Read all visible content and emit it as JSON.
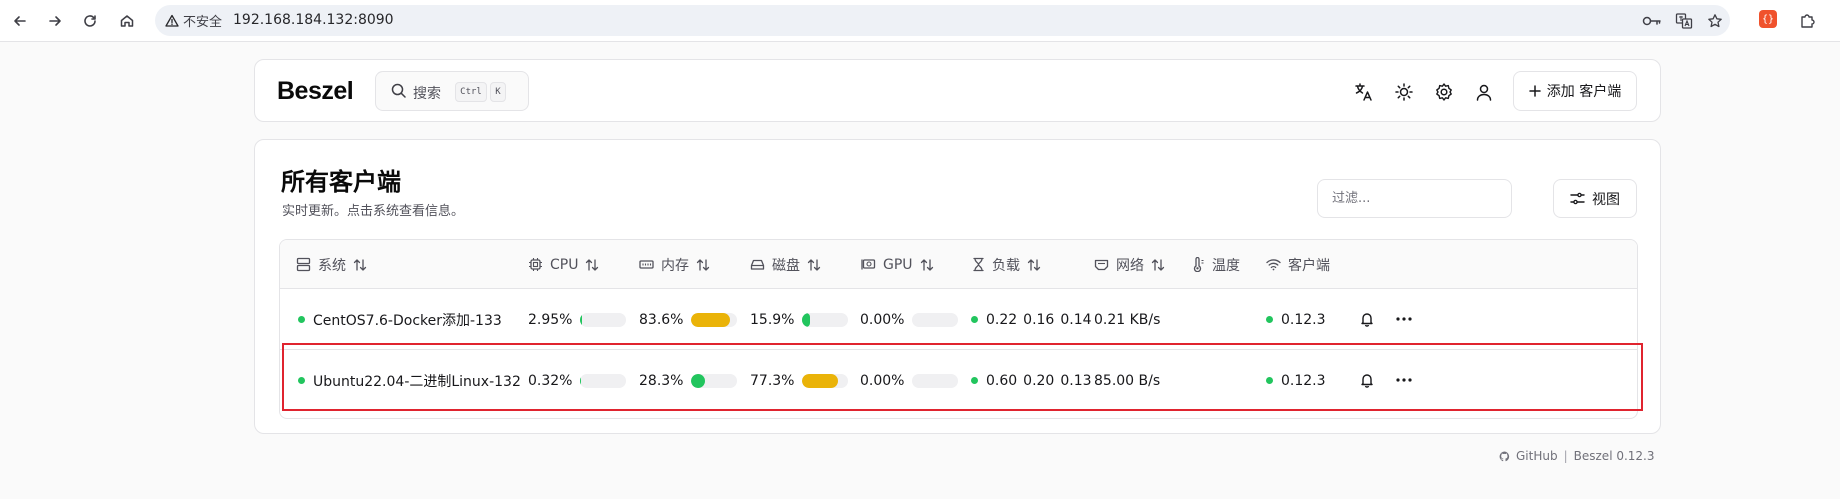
{
  "browser": {
    "security_label": "不安全",
    "url": "192.168.184.132:8090"
  },
  "header": {
    "logo": "Beszel",
    "search_label": "搜索",
    "kbd_ctrl": "Ctrl",
    "kbd_k": "K",
    "add_client_label": "添加 客户端"
  },
  "page": {
    "title": "所有客户端",
    "subtitle": "实时更新。点击系统查看信息。",
    "filter_placeholder": "过滤...",
    "view_label": "视图"
  },
  "table": {
    "columns": [
      "系统",
      "CPU",
      "内存",
      "磁盘",
      "GPU",
      "负载",
      "网络",
      "温度",
      "客户端"
    ],
    "rows": [
      {
        "system": "CentOS7.6-Docker添加-133",
        "status": "up",
        "cpu": "2.95%",
        "cpu_pct": 2.95,
        "mem": "83.6%",
        "mem_pct": 83.6,
        "disk": "15.9%",
        "disk_pct": 15.9,
        "gpu": "0.00%",
        "gpu_pct": 0,
        "load": [
          "0.22",
          "0.16",
          "0.14"
        ],
        "net": "0.21 KB/s",
        "temp": "",
        "agent": "0.12.3"
      },
      {
        "system": "Ubuntu22.04-二进制Linux-132",
        "status": "up",
        "cpu": "0.32%",
        "cpu_pct": 0.32,
        "mem": "28.3%",
        "mem_pct": 28.3,
        "disk": "77.3%",
        "disk_pct": 77.3,
        "gpu": "0.00%",
        "gpu_pct": 0,
        "load": [
          "0.60",
          "0.20",
          "0.13"
        ],
        "net": "85.00 B/s",
        "temp": "",
        "agent": "0.12.3"
      }
    ]
  },
  "footer": {
    "github": "GitHub",
    "separator": "|",
    "version": "Beszel 0.12.3"
  },
  "colors": {
    "ok": "#22c55e",
    "warn": "#eab308",
    "highlight": "#e0242f"
  }
}
